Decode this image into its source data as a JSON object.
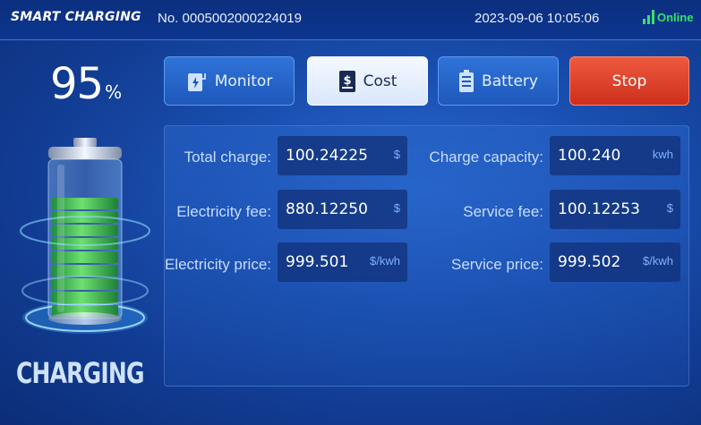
{
  "header": {
    "brand": "SMART CHARGING",
    "serial": "No. 0005002000224019",
    "datetime": "2023-09-06 10:05:06",
    "status": "Online",
    "status_color": "#37e06a"
  },
  "battery": {
    "percent_value": "95",
    "percent_symbol": "%",
    "level": 0.95,
    "state_label": "CHARGING"
  },
  "tabs": {
    "monitor": {
      "label": "Monitor",
      "icon": "charger-icon"
    },
    "cost": {
      "label": "Cost",
      "icon": "bill-icon",
      "active": true
    },
    "battery": {
      "label": "Battery",
      "icon": "battery-icon"
    },
    "stop": {
      "label": "Stop"
    }
  },
  "cost": {
    "total_charge": {
      "label": "Total charge:",
      "value": "100.24225",
      "unit": "$"
    },
    "electricity_fee": {
      "label": "Electricity fee:",
      "value": "880.12250",
      "unit": "$"
    },
    "electricity_price": {
      "label": "Electricity price:",
      "value": "999.501",
      "unit": "$/kwh"
    },
    "charge_capacity": {
      "label": "Charge capacity:",
      "value": "100.240",
      "unit": "kwh"
    },
    "service_fee": {
      "label": "Service fee:",
      "value": "100.12253",
      "unit": "$"
    },
    "service_price": {
      "label": "Service price:",
      "value": "999.502",
      "unit": "$/kwh"
    }
  },
  "colors": {
    "accent": "#2f73d8",
    "stop": "#e04a30",
    "value_unit": "#7fb2ff"
  }
}
